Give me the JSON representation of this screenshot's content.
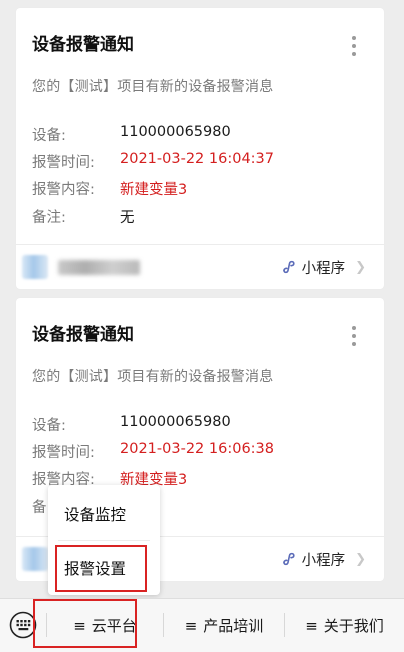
{
  "cards": [
    {
      "title": "设备报警通知",
      "intro": "您的【测试】项目有新的设备报警消息",
      "rows": [
        {
          "label": "设备:",
          "value": "110000065980"
        },
        {
          "label": "报警时间:",
          "value": "2021-03-22 16:04:37"
        },
        {
          "label": "报警内容:",
          "value": "新建变量3"
        },
        {
          "label": "备注:",
          "value": "无"
        }
      ],
      "footer_link": "小程序"
    },
    {
      "title": "设备报警通知",
      "intro": "您的【测试】项目有新的设备报警消息",
      "rows": [
        {
          "label": "设备:",
          "value": "110000065980"
        },
        {
          "label": "报警时间:",
          "value": "2021-03-22 16:06:38"
        },
        {
          "label": "报警内容:",
          "value": "新建变量3"
        },
        {
          "label": "备",
          "value": ""
        }
      ],
      "footer_link": "小程序"
    }
  ],
  "menu": {
    "items": [
      "云平台",
      "产品培训",
      "关于我们"
    ],
    "hamburger_glyph": "≡",
    "submenu": [
      "设备监控",
      "报警设置"
    ]
  },
  "colors": {
    "alert_value": "#d41f1f",
    "highlight_box": "#d92323"
  },
  "icons": [
    "more-vertical-icon",
    "mini-program-icon",
    "chevron-right-icon",
    "keyboard-icon"
  ]
}
